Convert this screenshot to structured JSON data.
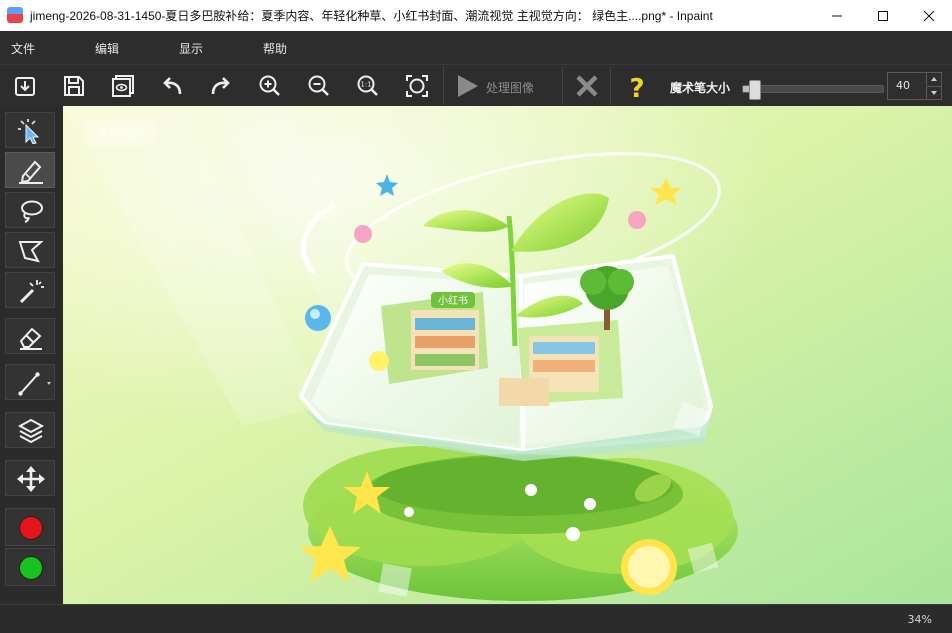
{
  "window": {
    "title": "jimeng-2026-08-31-1450-夏日多巴胺补给：夏季内容、年轻化种草、小红书封面、潮流视觉 主视觉方向： 绿色主....png* - Inpaint"
  },
  "menu": {
    "items": [
      "文件",
      "编辑",
      "显示",
      "帮助"
    ]
  },
  "toolbar": {
    "process_label": "处理图像",
    "brush_size_label": "魔术笔大小",
    "brush_size_value": "40",
    "brush_size_fraction": 0.08
  },
  "tools": [
    {
      "name": "marker-select",
      "active": false
    },
    {
      "name": "marker",
      "active": true
    },
    {
      "name": "lasso",
      "active": false
    },
    {
      "name": "polygon-lasso",
      "active": false
    },
    {
      "name": "magic-wand",
      "active": false
    },
    {
      "name": "eraser",
      "active": false
    },
    {
      "name": "line",
      "active": false
    },
    {
      "name": "layers",
      "active": false
    },
    {
      "name": "move",
      "active": false
    }
  ],
  "colors": {
    "mask_color": "#e8141c",
    "donor_color": "#19c21e",
    "ui_dark": "#2b2b2b"
  },
  "canvas": {
    "watermark": "AI生成",
    "badge_text": "小红书"
  },
  "status": {
    "zoom": "34%"
  }
}
